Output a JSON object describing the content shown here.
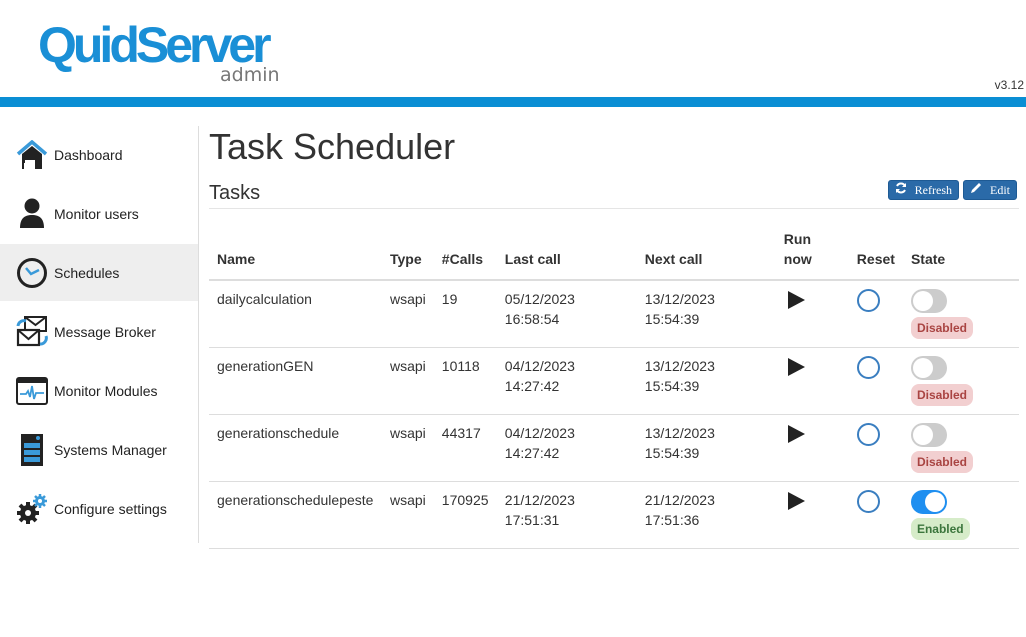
{
  "app": {
    "logo_main": "QuidServer",
    "logo_sub": "admin",
    "version": "v3.12",
    "brand_color": "#0a8ed4"
  },
  "sidebar": {
    "items": [
      {
        "label": "Dashboard",
        "icon": "home-icon",
        "active": false
      },
      {
        "label": "Monitor users",
        "icon": "user-icon",
        "active": false
      },
      {
        "label": "Schedules",
        "icon": "clock-icon",
        "active": true
      },
      {
        "label": "Message Broker",
        "icon": "mail-sync-icon",
        "active": false
      },
      {
        "label": "Monitor Modules",
        "icon": "pulse-monitor-icon",
        "active": false
      },
      {
        "label": "Systems Manager",
        "icon": "server-icon",
        "active": false
      },
      {
        "label": "Configure settings",
        "icon": "gears-icon",
        "active": false
      }
    ]
  },
  "main": {
    "title": "Task Scheduler",
    "section_title": "Tasks",
    "refresh_label": "Refresh",
    "edit_label": "Edit",
    "table": {
      "headers": {
        "name": "Name",
        "type": "Type",
        "calls": "#Calls",
        "last_call": "Last call",
        "next_call": "Next call",
        "run_now_1": "Run",
        "run_now_2": "now",
        "reset": "Reset",
        "state": "State"
      },
      "rows": [
        {
          "name": "dailycalculation",
          "type": "wsapi",
          "calls": "19",
          "last_date": "05/12/2023",
          "last_time": "16:58:54",
          "next_date": "13/12/2023",
          "next_time": "15:54:39",
          "enabled": false,
          "state_label": "Disabled"
        },
        {
          "name": "generationGEN",
          "type": "wsapi",
          "calls": "10118",
          "last_date": "04/12/2023",
          "last_time": "14:27:42",
          "next_date": "13/12/2023",
          "next_time": "15:54:39",
          "enabled": false,
          "state_label": "Disabled"
        },
        {
          "name": "generationschedule",
          "type": "wsapi",
          "calls": "44317",
          "last_date": "04/12/2023",
          "last_time": "14:27:42",
          "next_date": "13/12/2023",
          "next_time": "15:54:39",
          "enabled": false,
          "state_label": "Disabled"
        },
        {
          "name": "generationschedulepeste",
          "type": "wsapi",
          "calls": "170925",
          "last_date": "21/12/2023",
          "last_time": "17:51:31",
          "next_date": "21/12/2023",
          "next_time": "17:51:36",
          "enabled": true,
          "state_label": "Enabled"
        }
      ]
    }
  }
}
